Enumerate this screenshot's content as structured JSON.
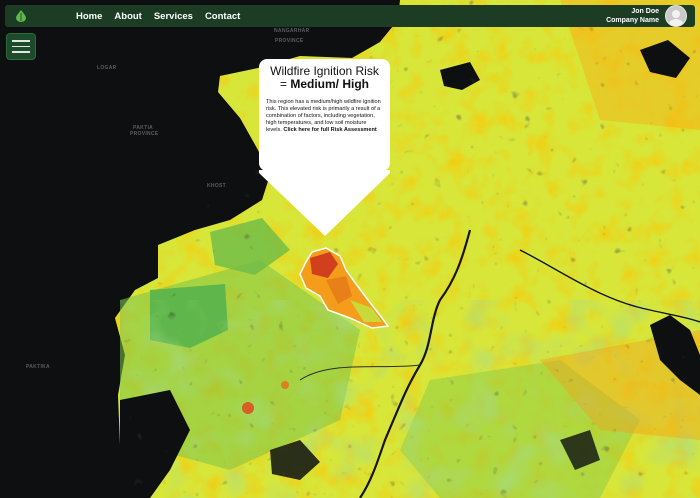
{
  "navbar": {
    "links": [
      "Home",
      "About",
      "Services",
      "Contact"
    ],
    "user_name": "Jon Doe",
    "company_name": "Company Name",
    "bg_color": "#1c3d24"
  },
  "map_labels": [
    {
      "text": "NANGARHAR"
    },
    {
      "text": "PROVINCE"
    },
    {
      "text": "LOGAR"
    },
    {
      "text": "PAKTIA"
    },
    {
      "text": "PROVINCE"
    },
    {
      "text": "KHOST"
    },
    {
      "text": "PAKTIKA"
    }
  ],
  "popup": {
    "title_prefix": "Wildfire Ignition Risk = ",
    "risk_level": "Medium/ High",
    "body": "This region has a medium/high wildfire ignition risk. This elevated risk is primarily a result of a combination of factors, including vegetation, high temperatures, and low soil moisture levels. ",
    "link_text": "Click here for full Risk Assessment"
  },
  "colors": {
    "accent": "#1c3d24",
    "risk_low": "#5fb64a",
    "risk_medium": "#d7e639",
    "risk_high": "#f3a21a",
    "risk_extreme": "#e14a1c",
    "background": "#0d0f10"
  }
}
